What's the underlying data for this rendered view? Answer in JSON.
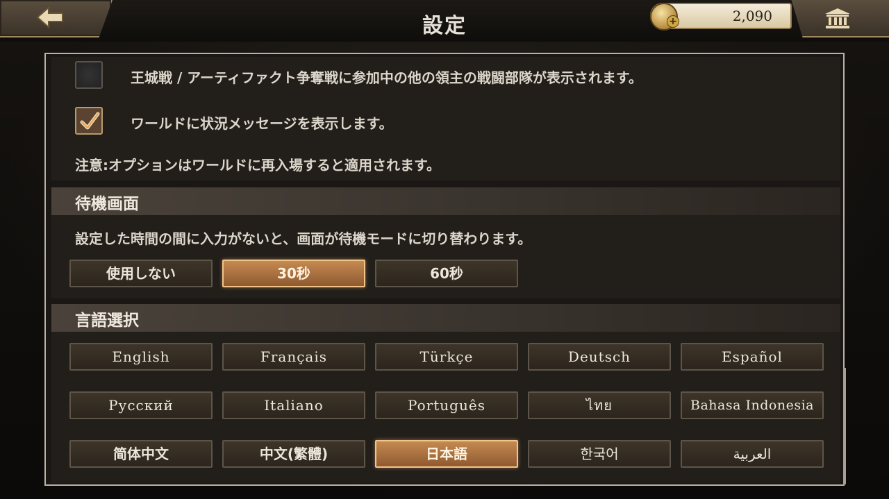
{
  "header": {
    "title": "設定",
    "gold_amount": "2,090",
    "gold_plus": "+"
  },
  "world_options": {
    "option1": {
      "label": "王城戦 / アーティファクト争奪戦に参加中の他の領主の戦闘部隊が表示されます。",
      "checked": false
    },
    "option2": {
      "label": "ワールドに状況メッセージを表示します。",
      "checked": true
    },
    "note": "注意:オプションはワールドに再入場すると適用されます。"
  },
  "standby": {
    "title": "待機画面",
    "description": "設定した時間の間に入力がないと、画面が待機モードに切り替わります。",
    "options": [
      "使用しない",
      "30秒",
      "60秒"
    ],
    "selected": "30秒"
  },
  "language": {
    "title": "言語選択",
    "options": [
      "English",
      "Français",
      "Türkçe",
      "Deutsch",
      "Español",
      "Русский",
      "Italiano",
      "Português",
      "ไทย",
      "Bahasa Indonesia",
      "简体中文",
      "中文(繁體)",
      "日本語",
      "한국어",
      "العربية"
    ],
    "selected": "日本語"
  },
  "colors": {
    "selected_fill": "#c58a52",
    "selected_border": "#f3c48a",
    "panel_border": "#b9b2a4"
  },
  "icons": [
    "back-arrow-icon",
    "gold-coin-icon",
    "bank-icon",
    "checkmark-icon"
  ]
}
